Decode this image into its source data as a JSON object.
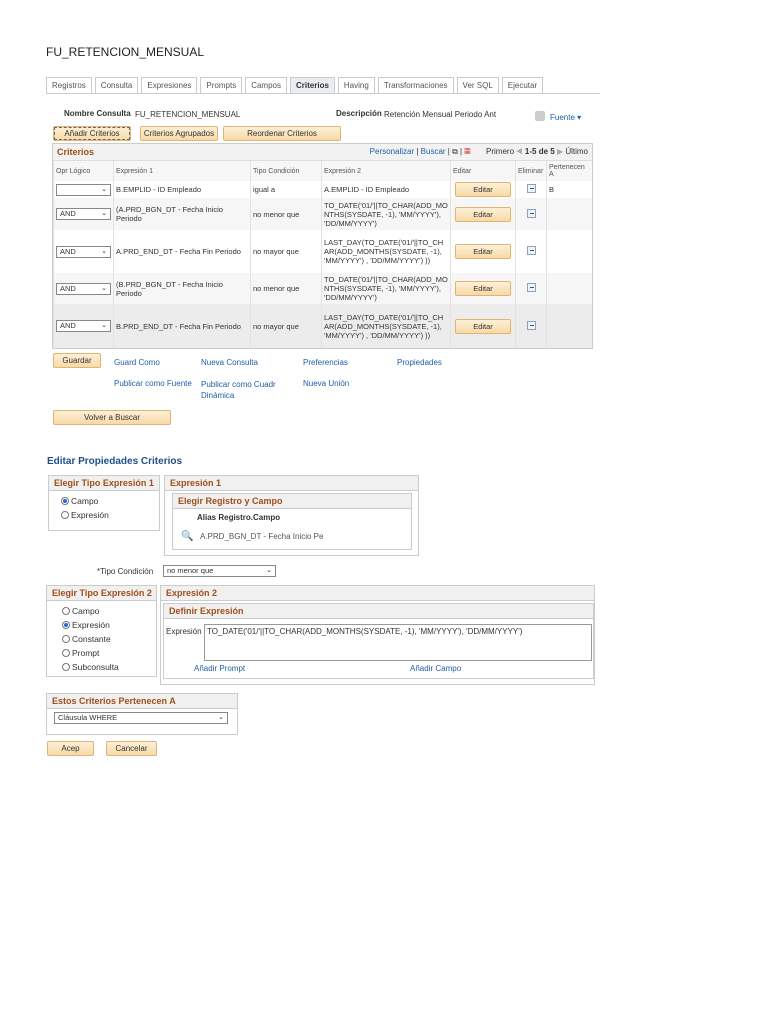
{
  "page_title": "FU_RETENCION_MENSUAL",
  "tabs": [
    "Registros",
    "Consulta",
    "Expresiones",
    "Prompts",
    "Campos",
    "Criterios",
    "Having",
    "Transformaciones",
    "Ver SQL",
    "Ejecutar"
  ],
  "active_tab": "Criterios",
  "query": {
    "name_label": "Nombre Consulta",
    "name": "FU_RETENCION_MENSUAL",
    "desc_label": "Descripción",
    "desc": "Retención Mensual Periodo Ant",
    "fuente": "Fuente"
  },
  "toolbar": {
    "add": "Añadir Criterios",
    "grouped": "Criterios Agrupados",
    "reorder": "Reordenar Criterios"
  },
  "grid": {
    "title": "Criterios",
    "personalizar": "Personalizar",
    "buscar": "Buscar",
    "primero": "Primero",
    "range": "1-5 de 5",
    "ultimo": "Último",
    "headers": [
      "Opr Lógico",
      "Expresión 1",
      "Tipo Condición",
      "Expresión 2",
      "Editar",
      "Eliminar",
      "Pertenecen A"
    ],
    "rows": [
      {
        "op": "",
        "e1": "B.EMPLID - ID Empleado",
        "cond": "igual a",
        "e2": "A.EMPLID - ID Empleado",
        "edit": "Editar",
        "belongs": "B"
      },
      {
        "op": "AND",
        "e1": "(A.PRD_BGN_DT - Fecha Inicio Periodo",
        "cond": "no menor que",
        "e2": "TO_DATE('01/'||TO_CHAR(ADD_MONTHS(SYSDATE, -1), 'MM/YYYY'), 'DD/MM/YYYY')",
        "edit": "Editar",
        "belongs": ""
      },
      {
        "op": "AND",
        "e1": "A.PRD_END_DT - Fecha Fin Periodo",
        "cond": "no mayor que",
        "e2": "LAST_DAY(TO_DATE('01/'||TO_CHAR(ADD_MONTHS(SYSDATE, -1), 'MM/YYYY') , 'DD/MM/YYYY') ))",
        "edit": "Editar",
        "belongs": ""
      },
      {
        "op": "AND",
        "e1": "(B.PRD_BGN_DT - Fecha Inicio Periodo",
        "cond": "no menor que",
        "e2": "TO_DATE('01/'||TO_CHAR(ADD_MONTHS(SYSDATE, -1), 'MM/YYYY'), 'DD/MM/YYYY')",
        "edit": "Editar",
        "belongs": ""
      },
      {
        "op": "AND",
        "e1": "B.PRD_END_DT - Fecha Fin Periodo",
        "cond": "no mayor que",
        "e2": "LAST_DAY(TO_DATE('01/'||TO_CHAR(ADD_MONTHS(SYSDATE, -1), 'MM/YYYY') , 'DD/MM/YYYY') ))",
        "edit": "Editar",
        "belongs": ""
      }
    ]
  },
  "actions": {
    "guardar": "Guardar",
    "guard_como": "Guard Como",
    "nueva_consulta": "Nueva Consulta",
    "preferencias": "Preferencias",
    "propiedades": "Propiedades",
    "publicar_fuente": "Publicar como Fuente",
    "publicar_cuadr": "Publicar como Cuadr Dinámica",
    "nueva_union": "Nueva Unión",
    "volver": "Volver a Buscar"
  },
  "edit": {
    "title": "Editar Propiedades Criterios",
    "type1_title": "Elegir Tipo Expresión 1",
    "type1_options": [
      "Campo",
      "Expresión"
    ],
    "type1_selected": "Campo",
    "expr1_title": "Expresión 1",
    "choose_title": "Elegir Registro y Campo",
    "alias_label": "Alias Registro.Campo",
    "field_value": "A.PRD_BGN_DT - Fecha Inicio Pe",
    "cond_label": "*Tipo Condición",
    "cond_value": "no menor que",
    "type2_title": "Elegir Tipo Expresión 2",
    "type2_options": [
      "Campo",
      "Expresión",
      "Constante",
      "Prompt",
      "Subconsulta"
    ],
    "type2_selected": "Expresión",
    "expr2_title": "Expresión 2",
    "define_title": "Definir Expresión",
    "expr_label": "Expresión",
    "expr_value": "TO_DATE('01/'||TO_CHAR(ADD_MONTHS(SYSDATE, -1), 'MM/YYYY'), 'DD/MM/YYYY')",
    "add_prompt": "Añadir Prompt",
    "add_field": "Añadir Campo",
    "belongs_title": "Estos Criterios Pertenecen A",
    "belongs_value": "Cláusula WHERE",
    "ok": "Acep",
    "cancel": "Cancelar"
  }
}
